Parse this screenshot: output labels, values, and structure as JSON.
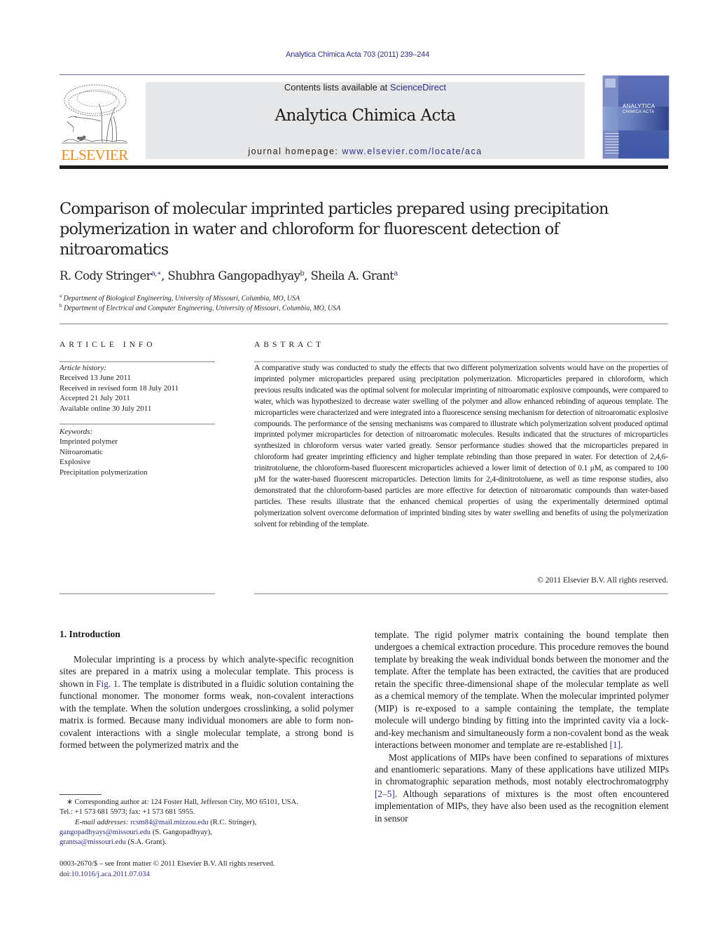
{
  "header": {
    "running_head": "Analytica Chimica Acta 703 (2011) 239–244",
    "contents_prefix": "Contents lists available at ",
    "contents_link": "ScienceDirect",
    "journal_title": "Analytica Chimica Acta",
    "homepage_prefix": "journal homepage: ",
    "homepage_link": "www.elsevier.com/locate/aca",
    "publisher_logo": "ELSEVIER",
    "cover_title_line1": "ANALYTICA",
    "cover_title_line2": "CHIMICA ACTA",
    "colors": {
      "link": "#2e2e8a",
      "elsevier_orange": "#f08a1d",
      "banner_bg": "#e6e7e8",
      "cover_blue": "#4e63ad"
    }
  },
  "article": {
    "title": "Comparison of molecular imprinted particles prepared using precipitation polymerization in water and chloroform for fluorescent detection of nitroaromatics",
    "authors": [
      {
        "name": "R. Cody Stringer",
        "sup": "a,∗"
      },
      {
        "name": "Shubhra Gangopadhyay",
        "sup": "b"
      },
      {
        "name": "Sheila A. Grant",
        "sup": "a"
      }
    ],
    "affiliations": [
      {
        "mark": "a",
        "text": "Department of Biological Engineering, University of Missouri, Columbia, MO, USA"
      },
      {
        "mark": "b",
        "text": "Department of Electrical and Computer Engineering, University of Missouri, Columbia, MO, USA"
      }
    ]
  },
  "article_info": {
    "heading": "ARTICLE INFO",
    "history_label": "Article history:",
    "history": [
      "Received 13 June 2011",
      "Received in revised form 18 July 2011",
      "Accepted 21 July 2011",
      "Available online 30 July 2011"
    ],
    "keywords_label": "Keywords:",
    "keywords": [
      "Imprinted polymer",
      "Nitroaromatic",
      "Explosive",
      "Precipitation polymerization"
    ]
  },
  "abstract": {
    "heading": "ABSTRACT",
    "text": "A comparative study was conducted to study the effects that two different polymerization solvents would have on the properties of imprinted polymer microparticles prepared using precipitation polymerization. Microparticles prepared in chloroform, which previous results indicated was the optimal solvent for molecular imprinting of nitroaromatic explosive compounds, were compared to water, which was hypothesized to decrease water swelling of the polymer and allow enhanced rebinding of aqueous template. The microparticles were characterized and were integrated into a fluorescence sensing mechanism for detection of nitroaromatic explosive compounds. The performance of the sensing mechanisms was compared to illustrate which polymerization solvent produced optimal imprinted polymer microparticles for detection of nitroaromatic molecules. Results indicated that the structures of microparticles synthesized in chloroform versus water varied greatly. Sensor performance studies showed that the microparticles prepared in chloroform had greater imprinting efficiency and higher template rebinding than those prepared in water. For detection of 2,4,6-trinitrotoluene, the chloroform-based fluorescent microparticles achieved a lower limit of detection of 0.1 μM, as compared to 100 μM for the water-based fluorescent microparticles. Detection limits for 2,4-dinitrotoluene, as well as time response studies, also demonstrated that the chloroform-based particles are more effective for detection of nitroaromatic compounds than water-based particles. These results illustrate that the enhanced chemical properties of using the experimentally determined optimal polymerization solvent overcome deformation of imprinted binding sites by water swelling and benefits of using the polymerization solvent for rebinding of the template.",
    "copyright": "© 2011 Elsevier B.V. All rights reserved."
  },
  "intro": {
    "heading": "1.  Introduction",
    "left_p1_a": "Molecular imprinting is a process by which analyte-specific recognition sites are prepared in a matrix using a molecular template. This process is shown in ",
    "left_p1_link": "Fig. 1",
    "left_p1_b": ". The template is distributed in a fluidic solution containing the functional monomer. The monomer forms weak, non-covalent interactions with the template. When the solution undergoes crosslinking, a solid polymer matrix is formed. Because many individual monomers are able to form non-covalent interactions with a single molecular template, a strong bond is formed between the polymerized matrix and the",
    "right_p1_a": "template. The rigid polymer matrix containing the bound template then undergoes a chemical extraction procedure. This procedure removes the bound template by breaking the weak individual bonds between the monomer and the template. After the template has been extracted, the cavities that are produced retain the specific three-dimensional shape of the molecular template as well as a chemical memory of the template. When the molecular imprinted polymer (MIP) is re-exposed to a sample containing the template, the template molecule will undergo binding by fitting into the imprinted cavity via a lock-and-key mechanism and simultaneously form a non-covalent bond as the weak interactions between monomer and template are re-established ",
    "right_p1_ref": "[1]",
    "right_p1_b": ".",
    "right_p2_a": "Most applications of MIPs have been confined to separations of mixtures and enantiomeric separations. Many of these applications have utilized MIPs in chromatographic separation methods, most notably electrochromatogrphy ",
    "right_p2_ref": "[2–5]",
    "right_p2_b": ". Although separations of mixtures is the most often encountered implementation of MIPs, they have also been used as the recognition element in sensor"
  },
  "footnotes": {
    "corresponding": "∗ Corresponding author at: 124 Foster Hall, Jefferson City, MO 65101, USA.",
    "tel": "Tel.: +1 573 681 5973; fax: +1 573 681 5955.",
    "email_label": "E-mail addresses: ",
    "emails": [
      {
        "address": "rcsm84@mail.mizzou.edu",
        "who": " (R.C. Stringer),"
      },
      {
        "address": "gangopadhyays@missouri.edu",
        "who": " (S. Gangopadhyay),"
      },
      {
        "address": "grantsa@missouri.edu",
        "who": " (S.A. Grant)."
      }
    ],
    "front_matter": "0003-2670/$ – see front matter © 2011 Elsevier B.V. All rights reserved.",
    "doi_prefix": "doi:",
    "doi_link": "10.1016/j.aca.2011.07.034"
  }
}
